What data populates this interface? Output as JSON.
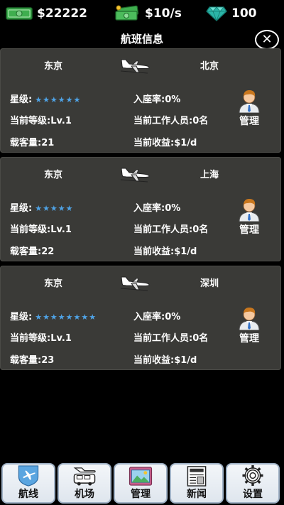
{
  "resources": {
    "money": "$22222",
    "income_rate": "$10/s",
    "gems": "100"
  },
  "title": "航班信息",
  "close_symbol": "✕",
  "star_glyph": "★",
  "routes": [
    {
      "from": "东京",
      "to": "北京",
      "star_label": "星级:",
      "stars": 6,
      "occupancy": "入座率:0%",
      "level": "当前等级:Lv.1",
      "staff": "当前工作人员:0名",
      "capacity": "载客量:21",
      "revenue": "当前收益:$1/d",
      "manage_label": "管理"
    },
    {
      "from": "东京",
      "to": "上海",
      "star_label": "星级:",
      "stars": 5,
      "occupancy": "入座率:0%",
      "level": "当前等级:Lv.1",
      "staff": "当前工作人员:0名",
      "capacity": "载客量:22",
      "revenue": "当前收益:$1/d",
      "manage_label": "管理"
    },
    {
      "from": "东京",
      "to": "深圳",
      "star_label": "星级:",
      "stars": 8,
      "occupancy": "入座率:0%",
      "level": "当前等级:Lv.1",
      "staff": "当前工作人员:0名",
      "capacity": "载客量:23",
      "revenue": "当前收益:$1/d",
      "manage_label": "管理"
    }
  ],
  "nav": [
    {
      "label": "航线",
      "icon": "route-plane-icon"
    },
    {
      "label": "机场",
      "icon": "airport-bus-icon"
    },
    {
      "label": "管理",
      "icon": "management-icon"
    },
    {
      "label": "新闻",
      "icon": "newspaper-icon"
    },
    {
      "label": "设置",
      "icon": "settings-gear-icon"
    }
  ],
  "colors": {
    "card_bg": "#3a3a37",
    "star": "#4fa3e6",
    "money_green": "#3fae4f",
    "gem_teal": "#2bb5a8"
  }
}
